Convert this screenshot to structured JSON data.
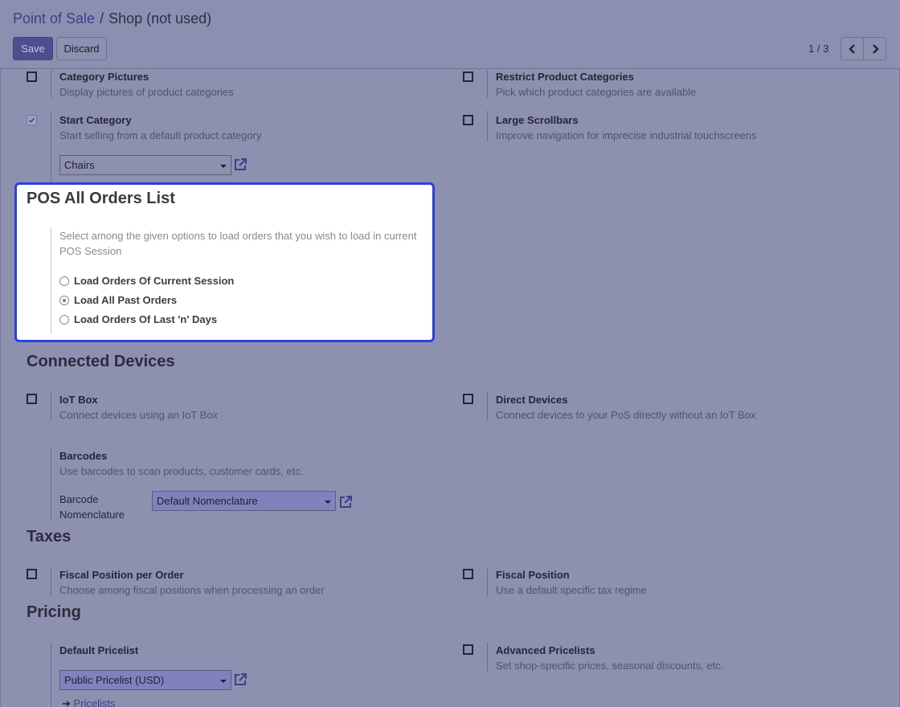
{
  "breadcrumb": {
    "parent": "Point of Sale",
    "separator": "/",
    "current": "Shop (not used)"
  },
  "toolbar": {
    "save_label": "Save",
    "discard_label": "Discard"
  },
  "pager": {
    "value": "1 / 3"
  },
  "settings": {
    "category_pictures": {
      "label": "Category Pictures",
      "desc": "Display pictures of product categories",
      "checked": false
    },
    "restrict_categories": {
      "label": "Restrict Product Categories",
      "desc": "Pick which product categories are available",
      "checked": false
    },
    "start_category": {
      "label": "Start Category",
      "desc": "Start selling from a default product category",
      "checked": true,
      "value": "Chairs"
    },
    "large_scrollbars": {
      "label": "Large Scrollbars",
      "desc": "Improve navigation for imprecise industrial touchscreens",
      "checked": false
    }
  },
  "orders_list": {
    "title": "POS All Orders List",
    "desc": "Select among the given options to load orders that you wish to load in current POS Session",
    "options": [
      {
        "label": "Load Orders Of Current Session",
        "selected": false
      },
      {
        "label": "Load All Past Orders",
        "selected": true
      },
      {
        "label": "Load Orders Of Last 'n' Days",
        "selected": false
      }
    ]
  },
  "connected_devices": {
    "title": "Connected Devices",
    "iot_box": {
      "label": "IoT Box",
      "desc": "Connect devices using an IoT Box",
      "checked": false
    },
    "direct_devices": {
      "label": "Direct Devices",
      "desc": "Connect devices to your PoS directly without an IoT Box",
      "checked": false
    },
    "barcodes": {
      "label": "Barcodes",
      "desc": "Use barcodes to scan products, customer cards, etc.",
      "nomenclature_label_1": "Barcode",
      "nomenclature_label_2": "Nomenclature",
      "nomenclature_value": "Default Nomenclature"
    }
  },
  "taxes": {
    "title": "Taxes",
    "fiscal_per_order": {
      "label": "Fiscal Position per Order",
      "desc": "Choose among fiscal positions when processing an order",
      "checked": false
    },
    "fiscal_position": {
      "label": "Fiscal Position",
      "desc": "Use a default specific tax regime",
      "checked": false
    }
  },
  "pricing": {
    "title": "Pricing",
    "default_pricelist": {
      "label": "Default Pricelist",
      "value": "Public Pricelist (USD)",
      "link": "Pricelists"
    },
    "advanced_pricelists": {
      "label": "Advanced Pricelists",
      "desc": "Set shop-specific prices, seasonal discounts, etc.",
      "checked": false
    }
  },
  "colors": {
    "accent": "#2b3fe6",
    "brand": "#4d4e8d",
    "overlay": "#8d90ae"
  }
}
